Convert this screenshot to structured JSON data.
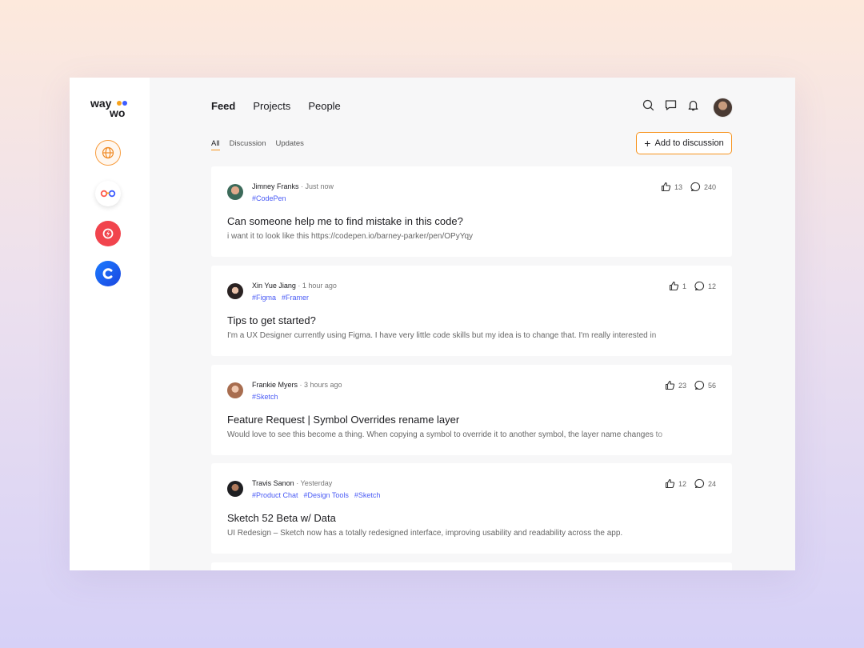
{
  "brand": {
    "line1": "way",
    "line2": "wo"
  },
  "sidebar": {
    "apps": [
      {
        "icon": "globe-icon"
      },
      {
        "icon": "glasses-icon"
      },
      {
        "icon": "red-app-icon"
      },
      {
        "icon": "c-app-icon"
      }
    ]
  },
  "topnav": {
    "feed": "Feed",
    "projects": "Projects",
    "people": "People"
  },
  "header_icons": [
    "search-icon",
    "chat-icon",
    "bell-icon"
  ],
  "subtabs": {
    "all": "All",
    "discussion": "Discussion",
    "updates": "Updates"
  },
  "add_button": {
    "plus": "+",
    "label": "Add to discussion"
  },
  "accent_color": "#f7931e",
  "tag_color": "#4a5bf5",
  "posts": [
    {
      "author": "Jimney Franks",
      "time": " · Just now",
      "tags": [
        "#CodePen"
      ],
      "title": "Can someone help me to find mistake in this code?",
      "excerpt": "i want it to look like this https://codepen.io/barney-parker/pen/OPyYqy",
      "likes": "13",
      "comments": "240"
    },
    {
      "author": "Xin Yue Jiang",
      "time": " · 1 hour ago",
      "tags": [
        "#Figma",
        "#Framer"
      ],
      "title": "Tips to get started?",
      "excerpt": "I'm a UX Designer currently using Figma. I have very little code skills but my idea is to change that. I'm really interested in",
      "likes": "1",
      "comments": "12"
    },
    {
      "author": "Frankie Myers",
      "time": " · 3 hours ago",
      "tags": [
        "#Sketch"
      ],
      "title": "Feature Request | Symbol Overrides rename layer",
      "excerpt": "Would love to see this become a thing. When copying a symbol to override it to another symbol, the layer name changes to",
      "likes": "23",
      "comments": "56"
    },
    {
      "author": "Travis Sanon",
      "time": " · Yesterday",
      "tags": [
        "#Product Chat",
        "#Design Tools",
        "#Sketch"
      ],
      "title": "Sketch 52 Beta w/ Data",
      "excerpt": "UI Redesign – Sketch now has a totally redesigned interface, improving usability and readability across the app.",
      "likes": "12",
      "comments": "24"
    }
  ]
}
